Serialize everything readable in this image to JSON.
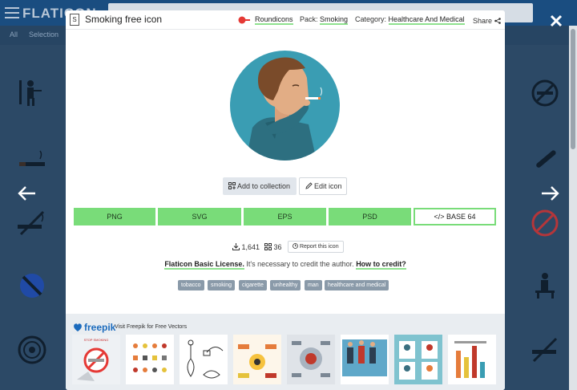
{
  "background": {
    "logo": "FLATICON",
    "tab_all": "All",
    "tab_selection": "Selection"
  },
  "modal": {
    "title": "Smoking free icon",
    "author": "Roundicons",
    "pack_label": "Pack:",
    "pack_value": "Smoking",
    "category_label": "Category:",
    "category_value": "Healthcare And Medical",
    "share_label": "Share",
    "add_to_collection": "Add to collection",
    "edit_icon": "Edit icon",
    "formats": [
      "PNG",
      "SVG",
      "EPS",
      "PSD",
      "</> BASE 64"
    ],
    "downloads": "1,641",
    "collections_count": "36",
    "report": "Report this icon",
    "license_name": "Flaticon Basic License.",
    "license_text": "It's necessary to credit the author.",
    "how_to_credit": "How to credit?",
    "tags": [
      "tobacco",
      "smoking",
      "cigarette",
      "unhealthy",
      "man",
      "healthcare and medical"
    ]
  },
  "promo": {
    "brand": "freepik",
    "text": "Visit Freepik for Free Vectors",
    "thumb_1_caption": "STOP SMOKING"
  },
  "icons": {
    "prev": "arrow-left-icon",
    "next": "arrow-right-icon",
    "close": "close-icon"
  },
  "colors": {
    "accent_green": "#79dc79",
    "hero_circle": "#3a9db3",
    "header_blue": "#1a4d80"
  }
}
